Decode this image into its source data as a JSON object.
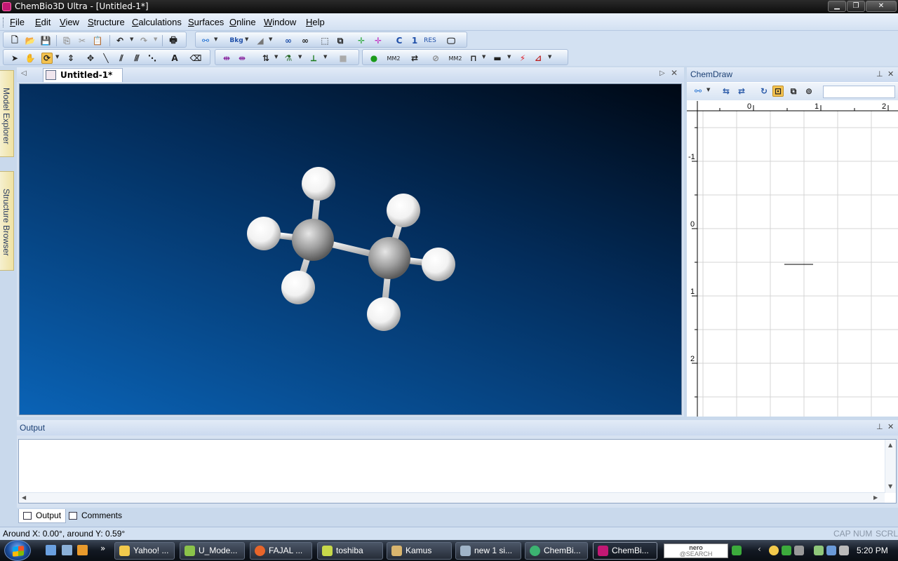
{
  "window": {
    "title": "ChemBio3D Ultra - [Untitled-1*]"
  },
  "menu": [
    "File",
    "Edit",
    "View",
    "Structure",
    "Calculations",
    "Surfaces",
    "Online",
    "Window",
    "Help"
  ],
  "toolbar": {
    "c_label": "C",
    "one_label": "1",
    "res_label": "RES",
    "mm2_label": "MM2",
    "mm2b_label": "MM2",
    "text_tool": "A"
  },
  "sidebar": {
    "tabs": [
      "Model Explorer",
      "Structure Browser"
    ]
  },
  "document": {
    "tab_label": "Untitled-1*",
    "molecule": {
      "name": "ethane",
      "atoms": [
        {
          "element": "C"
        },
        {
          "element": "C"
        },
        {
          "element": "H"
        },
        {
          "element": "H"
        },
        {
          "element": "H"
        },
        {
          "element": "H"
        },
        {
          "element": "H"
        },
        {
          "element": "H"
        }
      ]
    },
    "background_colors": [
      "#000814",
      "#0a63b6"
    ]
  },
  "chemdraw": {
    "title": "ChemDraw",
    "ruler_x": [
      "0",
      "1",
      "2"
    ],
    "ruler_y": [
      "-1",
      "0",
      "1",
      "2"
    ]
  },
  "output": {
    "title": "Output",
    "tabs": [
      "Output",
      "Comments"
    ]
  },
  "status": {
    "text": "Around X: 0.00°, around Y: 0.59°",
    "indicators": [
      "CAP",
      "NUM",
      "SCRL"
    ]
  },
  "taskbar": {
    "items": [
      {
        "label": "Yahoo! ...",
        "color": "#f2c94c"
      },
      {
        "label": "U_Mode...",
        "color": "#8bc34a"
      },
      {
        "label": "FAJAL ...",
        "color": "#e8652a"
      },
      {
        "label": "toshiba",
        "color": "#c7d84a"
      },
      {
        "label": "Kamus",
        "color": "#d9b56e"
      },
      {
        "label": "new 1 si...",
        "color": "#a0b4c8"
      },
      {
        "label": "ChemBi...",
        "color": "#3cb371"
      },
      {
        "label": "ChemBi...",
        "color": "#c21874"
      }
    ],
    "nero_label_top": "nero",
    "nero_label_bottom": "@SEARCH",
    "clock": "5:20 PM"
  }
}
